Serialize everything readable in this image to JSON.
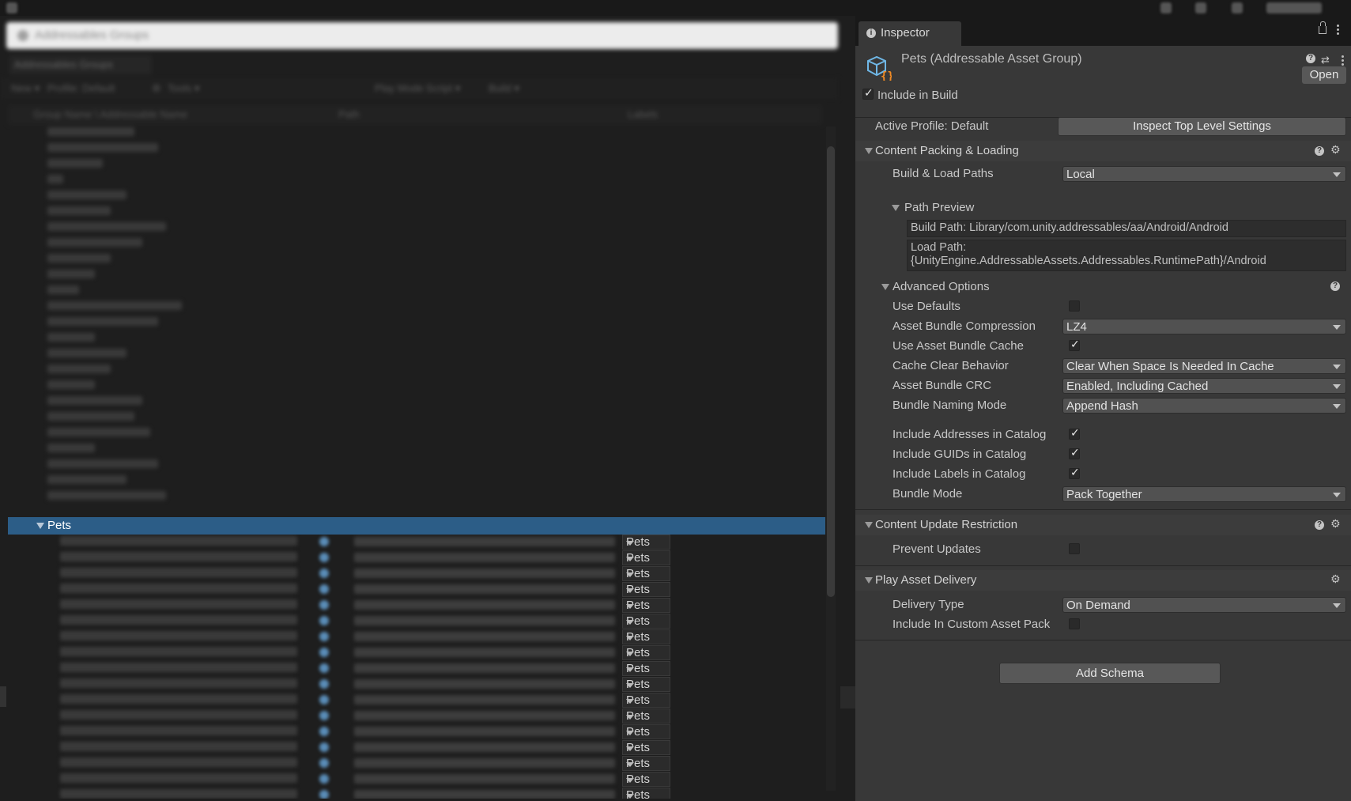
{
  "left_window": {
    "title": "Addressables Groups",
    "tab": "Addressables Groups",
    "toolbar": [
      "New ▾",
      "Profile: Default",
      "⚙",
      "Tools ▾",
      "Play Mode Script ▾",
      "Build ▾"
    ],
    "columns": [
      "Group Name \\ Addressable Name",
      "Path",
      "Labels"
    ],
    "selected_group": "Pets",
    "child_label_value": "Pets",
    "child_row_count": 17
  },
  "inspector": {
    "tab_label": "Inspector",
    "header": {
      "title": "Pets (Addressable Asset Group)",
      "open_button": "Open"
    },
    "include_in_build": {
      "label": "Include in Build",
      "checked": true
    },
    "active_profile": {
      "label": "Active Profile: Default",
      "button": "Inspect Top Level Settings"
    },
    "content_packing": {
      "title": "Content Packing & Loading",
      "build_load_paths": {
        "label": "Build & Load Paths",
        "value": "Local"
      },
      "path_preview": {
        "title": "Path Preview",
        "build_path": "Build Path: Library/com.unity.addressables/aa/Android/Android",
        "load_path_1": "Load Path:",
        "load_path_2": "{UnityEngine.AddressableAssets.Addressables.RuntimePath}/Android"
      },
      "advanced": {
        "title": "Advanced Options",
        "use_defaults": {
          "label": "Use Defaults",
          "checked": false
        },
        "compression": {
          "label": "Asset Bundle Compression",
          "value": "LZ4"
        },
        "use_cache": {
          "label": "Use Asset Bundle Cache",
          "checked": true
        },
        "cache_clear": {
          "label": "Cache Clear Behavior",
          "value": "Clear When Space Is Needed In Cache"
        },
        "crc": {
          "label": "Asset Bundle CRC",
          "value": "Enabled, Including Cached"
        },
        "naming": {
          "label": "Bundle Naming Mode",
          "value": "Append Hash"
        },
        "addresses": {
          "label": "Include Addresses in Catalog",
          "checked": true
        },
        "guids": {
          "label": "Include GUIDs in Catalog",
          "checked": true
        },
        "labels": {
          "label": "Include Labels in Catalog",
          "checked": true
        },
        "bundle_mode": {
          "label": "Bundle Mode",
          "value": "Pack Together"
        }
      }
    },
    "content_update": {
      "title": "Content Update Restriction",
      "prevent_updates": {
        "label": "Prevent Updates",
        "checked": false
      }
    },
    "play_asset_delivery": {
      "title": "Play Asset Delivery",
      "delivery_type": {
        "label": "Delivery Type",
        "value": "On Demand"
      },
      "custom_pack": {
        "label": "Include In Custom Asset Pack",
        "checked": false
      }
    },
    "add_schema": "Add Schema"
  },
  "colors": {
    "selection": "#2c5d87",
    "panel": "#383838",
    "dropdown": "#515151",
    "button": "#585858"
  }
}
